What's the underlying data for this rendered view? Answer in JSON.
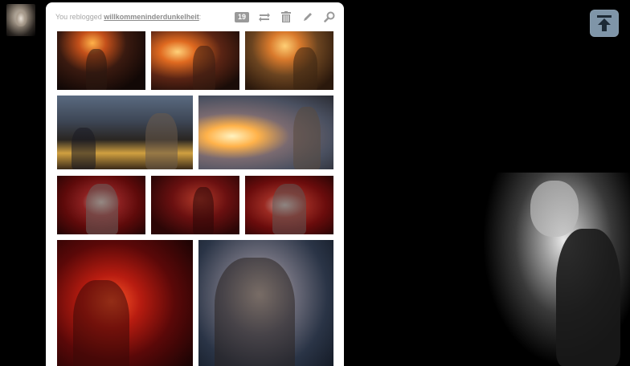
{
  "post": {
    "reblog_prefix": "You reblogged",
    "reblog_source": "willkommeninderdunkelheit",
    "reblog_suffix": ":",
    "notes_count": "19"
  },
  "controls": {
    "icons": [
      "reblog-icon",
      "trash-icon",
      "edit-icon",
      "search-icon"
    ]
  },
  "colors": {
    "background": "#000000",
    "card": "#ffffff",
    "note_badge": "#9a9a9a",
    "top_button": "#7f95a8"
  },
  "photos_count": 10
}
